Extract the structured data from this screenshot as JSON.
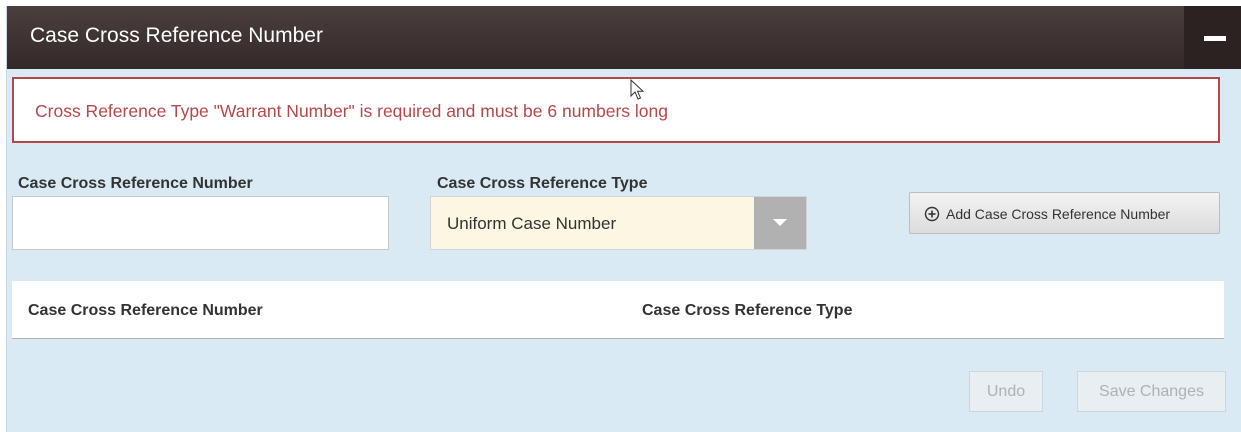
{
  "panel": {
    "title": "Case Cross Reference Number",
    "collapse_icon": "minus-icon"
  },
  "alert": {
    "message": "Cross Reference Type \"Warrant Number\" is required and must be 6 numbers long",
    "color": "#b5484a"
  },
  "form": {
    "number_label": "Case Cross Reference Number",
    "number_value": "",
    "type_label": "Case Cross Reference Type",
    "type_selected": "Uniform Case Number",
    "add_button_label": "Add Case Cross Reference Number",
    "add_button_icon": "plus-circle-icon"
  },
  "table": {
    "columns": [
      "Case Cross Reference Number",
      "Case Cross Reference Type"
    ],
    "rows": []
  },
  "actions": {
    "undo_label": "Undo",
    "save_label": "Save Changes"
  },
  "colors": {
    "header_bg": "#3a302f",
    "panel_bg": "#d9eaf4",
    "select_bg": "#fcf7e3"
  }
}
